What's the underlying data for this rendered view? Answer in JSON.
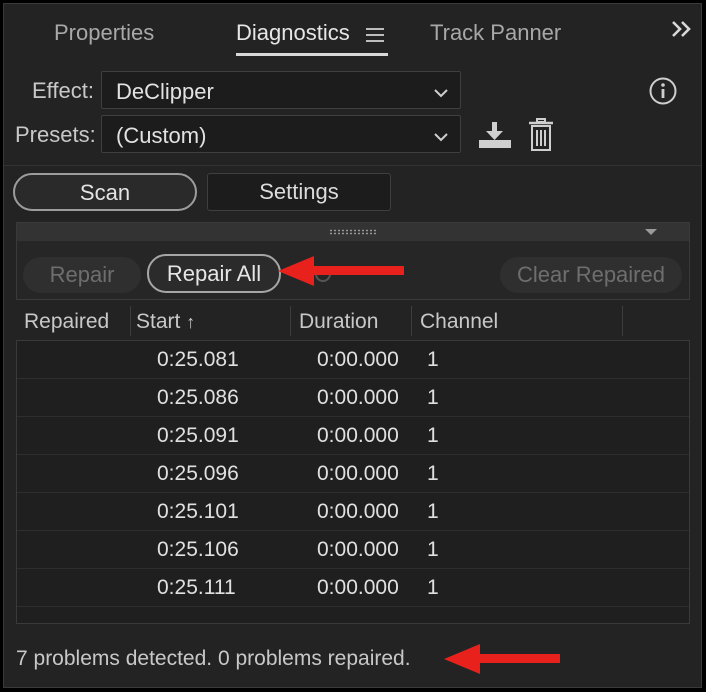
{
  "tabs": [
    {
      "label": "Properties",
      "active": false
    },
    {
      "label": "Diagnostics",
      "active": true
    },
    {
      "label": "Track Panner",
      "active": false
    }
  ],
  "effect": {
    "label": "Effect:",
    "value": "DeClipper"
  },
  "presets": {
    "label": "Presets:",
    "value": "(Custom)"
  },
  "mode_buttons": {
    "scan": "Scan",
    "settings": "Settings"
  },
  "actions": {
    "repair": "Repair",
    "repair_all": "Repair All",
    "clear_repaired": "Clear Repaired"
  },
  "table": {
    "headers": [
      "Repaired",
      "Start",
      "Duration",
      "Channel"
    ],
    "sort_indicator": "↑",
    "rows": [
      {
        "repaired": "",
        "start": "0:25.081",
        "duration": "0:00.000",
        "channel": "1"
      },
      {
        "repaired": "",
        "start": "0:25.086",
        "duration": "0:00.000",
        "channel": "1"
      },
      {
        "repaired": "",
        "start": "0:25.091",
        "duration": "0:00.000",
        "channel": "1"
      },
      {
        "repaired": "",
        "start": "0:25.096",
        "duration": "0:00.000",
        "channel": "1"
      },
      {
        "repaired": "",
        "start": "0:25.101",
        "duration": "0:00.000",
        "channel": "1"
      },
      {
        "repaired": "",
        "start": "0:25.106",
        "duration": "0:00.000",
        "channel": "1"
      },
      {
        "repaired": "",
        "start": "0:25.111",
        "duration": "0:00.000",
        "channel": "1"
      }
    ]
  },
  "status_text": "7 problems detected. 0 problems repaired.",
  "colors": {
    "panel_bg": "#232323",
    "annotation_arrow": "#e8211c",
    "accent_text": "#e6e6e6"
  },
  "icons": [
    "hamburger-menu-icon",
    "double-chevron-right-icon",
    "chevron-down-icon",
    "info-icon",
    "save-preset-icon",
    "trash-icon",
    "grip-icon",
    "spinner-icon",
    "sort-up-arrow-icon"
  ]
}
